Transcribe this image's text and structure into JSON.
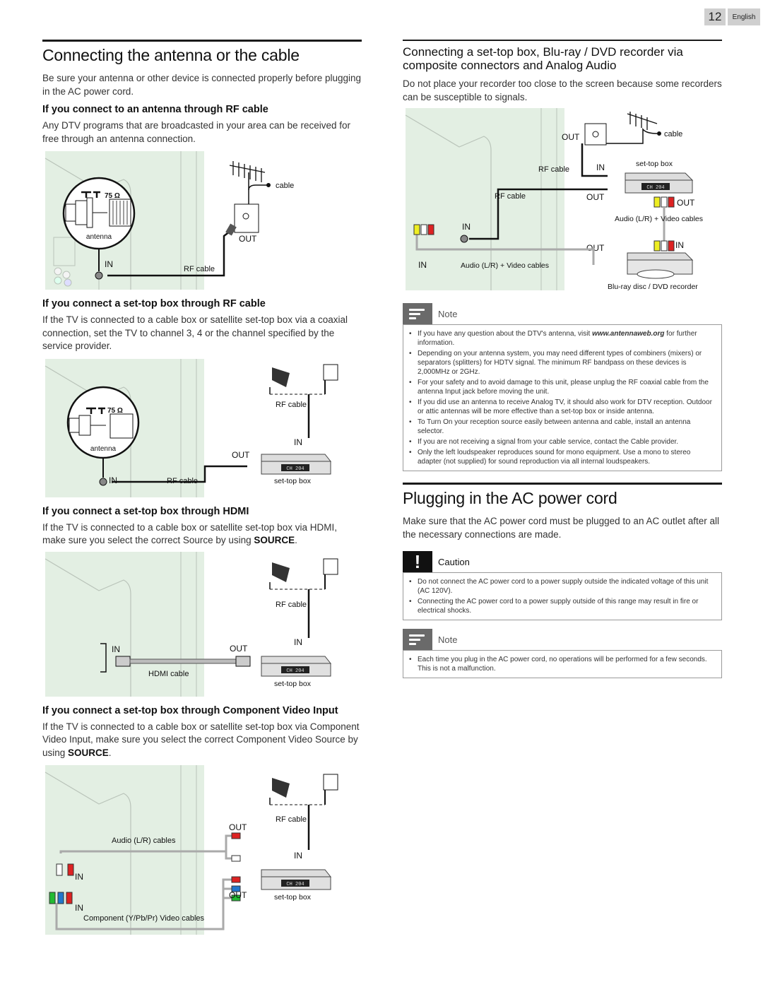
{
  "header": {
    "page_number": "12",
    "language": "English"
  },
  "left": {
    "title": "Connecting the antenna or the cable",
    "intro": "Be sure your antenna or other device is connected properly before plugging in the AC power cord.",
    "sections": [
      {
        "heading": "If you connect to an antenna through RF cable",
        "body": "Any DTV programs that are broadcasted in your area can be received for free through an antenna connection.",
        "diagram": {
          "impedance": "75 Ω",
          "connector_label": "antenna",
          "in": "IN",
          "cable": "RF cable",
          "out": "OUT",
          "source": "cable"
        }
      },
      {
        "heading": "If you connect a set-top box through RF cable",
        "body": "If the TV is connected to a cable box or satellite set-top box via a coaxial connection, set the TV to channel 3, 4 or the channel specified by the service provider.",
        "diagram": {
          "impedance": "75 Ω",
          "connector_label": "antenna",
          "in": "IN",
          "cable": "RF cable",
          "rf_top": "RF cable",
          "stb_in": "IN",
          "out": "OUT",
          "stb_display": "CH 204",
          "stb": "set-top box"
        }
      },
      {
        "heading": "If you connect a set-top box through HDMI",
        "body_pre": "If the TV is connected to a cable box or satellite set-top box via HDMI, make sure you select the correct Source by using ",
        "body_key": "SOURCE",
        "body_post": ".",
        "diagram": {
          "in": "IN",
          "cable": "HDMI cable",
          "out": "OUT",
          "rf_top": "RF cable",
          "stb_in": "IN",
          "stb_display": "CH 204",
          "stb": "set-top box"
        }
      },
      {
        "heading": "If you connect a set-top box through Component Video Input",
        "body_pre": "If the TV is connected to a cable box or satellite set-top box via Component Video Input, make sure you select the correct Component Video Source by using ",
        "body_key": "SOURCE",
        "body_post": ".",
        "diagram": {
          "audio_cables": "Audio (L/R) cables",
          "out_top": "OUT",
          "in_top": "IN",
          "in_bottom": "IN",
          "out_bottom": "OUT",
          "component_cables": "Component (Y/Pb/Pr) Video cables",
          "rf_top": "RF cable",
          "stb_in": "IN",
          "stb_display": "CH 204",
          "stb": "set-top box"
        }
      }
    ]
  },
  "right": {
    "title": "Connecting a set-top box, Blu-ray / DVD recorder via composite connectors and Analog Audio",
    "intro": "Do not place your recorder too close to the screen because some recorders can be susceptible to signals.",
    "diagram": {
      "wall_out": "OUT",
      "source": "cable",
      "rf_cable_1": "RF cable",
      "stb_in": "IN",
      "stb": "set-top box",
      "rf_cable_2": "RF cable",
      "stb_out": "OUT",
      "stb_display": "CH 204",
      "stb_av_out": "OUT",
      "tv_in": "IN",
      "av_cables": "Audio (L/R) + Video cables",
      "av_cables_2": "Audio (L/R) + Video cables",
      "rec_in": "IN",
      "rec_out": "OUT",
      "tv_av_in": "IN",
      "recorder": "Blu-ray disc / DVD recorder"
    },
    "note1": {
      "title": "Note",
      "items": [
        {
          "pre": "If you have any question about the DTV's antenna, visit ",
          "link": "www.antennaweb.org",
          "post": " for further information."
        },
        {
          "pre": "Depending on your antenna system, you may need different types of combiners (mixers) or separators (splitters) for HDTV signal. The minimum RF bandpass on these devices is 2,000MHz or 2GHz."
        },
        {
          "pre": "For your safety and to avoid damage to this unit, please unplug the RF coaxial cable from the antenna Input jack before moving the unit."
        },
        {
          "pre": "If you did use an antenna to receive Analog TV, it should also work for DTV reception. Outdoor or attic antennas will be more effective than a set-top box or inside antenna."
        },
        {
          "pre": "To Turn On your reception source easily between antenna and cable, install an antenna selector."
        },
        {
          "pre": "If you are not receiving a signal from your cable service, contact the Cable provider."
        },
        {
          "pre": "Only the left loudspeaker reproduces sound for mono equipment. Use a mono to stereo adapter (not supplied) for sound reproduction via all internal loudspeakers."
        }
      ]
    },
    "power": {
      "title": "Plugging in the AC power cord",
      "intro": "Make sure that the AC power cord must be plugged to an AC outlet after all the necessary connections are made.",
      "caution": {
        "title": "Caution",
        "items": [
          "Do not connect the AC power cord to a power supply outside the indicated voltage of this unit (AC 120V).",
          "Connecting the AC power cord to a power supply outside of this range may result in fire or electrical shocks."
        ]
      },
      "note": {
        "title": "Note",
        "items": [
          "Each time you plug in the AC power cord, no operations will be performed for a few seconds. This is not a malfunction."
        ]
      }
    }
  },
  "colors": {
    "tv_panel": "#e3efe3",
    "tv_line": "#b9c3b9",
    "cable": "#1a1a1a",
    "note_icon": "#6a6a6a",
    "caution_icon": "#111111"
  }
}
